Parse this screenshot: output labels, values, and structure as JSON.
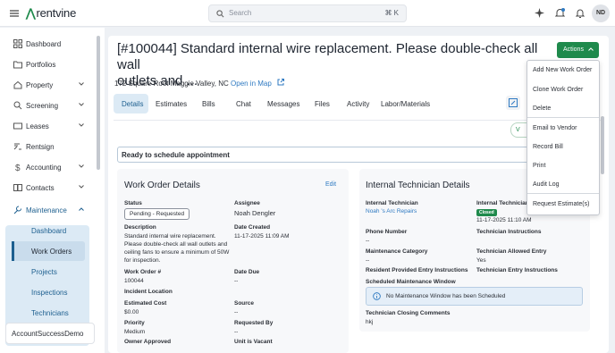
{
  "app": {
    "logo_text": "rentvine",
    "search_placeholder": "Search",
    "search_shortcut": "⌘ K",
    "user_initials": "ND",
    "colors": {
      "brand": "#1f8a4c",
      "accent": "#2f7ac2"
    }
  },
  "sidebar": {
    "items": [
      {
        "label": "Dashboard",
        "icon": "grid-icon"
      },
      {
        "label": "Portfolios",
        "icon": "folder-icon"
      },
      {
        "label": "Property",
        "icon": "home-icon"
      },
      {
        "label": "Screening",
        "icon": "search-icon"
      },
      {
        "label": "Leases",
        "icon": "lease-icon"
      },
      {
        "label": "Rentsign",
        "icon": "sign-icon"
      },
      {
        "label": "Accounting",
        "icon": "dollar-icon"
      },
      {
        "label": "Contacts",
        "icon": "contacts-icon"
      },
      {
        "label": "Maintenance",
        "icon": "wrench-icon"
      }
    ],
    "maintenance_sub": [
      "Dashboard",
      "Work Orders",
      "Projects",
      "Inspections",
      "Technicians"
    ],
    "account": "AccountSuccessDemo"
  },
  "work_order": {
    "title_line1": "[#100044] Standard internal wire replacement. Please double-check all wall",
    "title_line2": "outlets and ...",
    "address": "172 Square Root Maggie Valley, NC",
    "map_link": "Open in Map",
    "actions_label": "Actions",
    "tabs": [
      "Details",
      "Estimates",
      "Bills",
      "Chat",
      "Messages",
      "Files",
      "Activity",
      "Labor/Materials"
    ],
    "status": "Ready to schedule appointment",
    "v_button": "V"
  },
  "details": {
    "title": "Work Order Details",
    "edit": "Edit",
    "status_label": "Status",
    "status_value": "Pending - Requested",
    "assignee_label": "Assignee",
    "assignee_value": "Noah Dengler",
    "description_label": "Description",
    "description_value": "Standard internal wire replacement. Please double-check all wall outlets and ceiling fans to ensure a minimum of 50W for inspection.",
    "date_created_label": "Date Created",
    "date_created_value": "11-17-2025 11:09 AM",
    "wo_number_label": "Work Order #",
    "wo_number_value": "100044",
    "date_due_label": "Date Due",
    "date_due_value": "--",
    "incident_label": "Incident Location",
    "est_cost_label": "Estimated Cost",
    "est_cost_value": "$0.00",
    "source_label": "Source",
    "source_value": "--",
    "priority_label": "Priority",
    "priority_value": "Medium",
    "requested_by_label": "Requested By",
    "requested_by_value": "--",
    "owner_approved_label": "Owner Approved",
    "unit_vacant_label": "Unit is Vacant"
  },
  "tech": {
    "title": "Internal Technician Details",
    "internal_tech_label": "Internal Technician",
    "internal_tech_value": "Noah 's Arc Repairs",
    "internal_tech2_label": "Internal Technician",
    "closed_badge": "Closed",
    "closed_date": "11-17-2025 11:10 AM",
    "phone_label": "Phone Number",
    "phone_value": "--",
    "tech_instr_label": "Technician Instructions",
    "maint_cat_label": "Maintenance Category",
    "maint_cat_value": "--",
    "allowed_entry_label": "Technician Allowed Entry",
    "allowed_entry_value": "Yes",
    "resident_entry_label": "Resident Provided Entry Instructions",
    "tech_entry_label": "Technician Entry Instructions",
    "sched_window_label": "Scheduled Maintenance Window",
    "no_window": "No Maintenance Window has been Scheduled",
    "closing_comments_label": "Technician Closing Comments",
    "closing_comments_value": "hkj"
  },
  "actions_menu": [
    "Add New Work Order",
    "Clone Work Order",
    "Delete",
    "Email to Vendor",
    "Record Bill",
    "Print",
    "Audit Log",
    "Request Estimate(s)"
  ]
}
